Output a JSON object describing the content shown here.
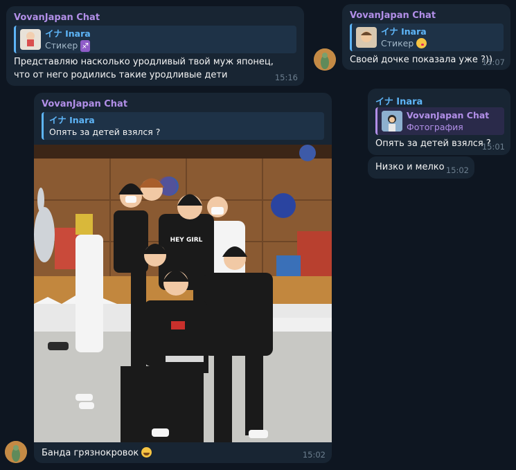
{
  "messages": {
    "m1": {
      "sender": "VovanJapan Chat",
      "reply_name": "イナ Inara",
      "reply_sub": "Стикер",
      "reply_emoji": "♐",
      "text": "Представляю насколько уродливый твой муж японец, что от него родились такие уродливые дети",
      "time": "15:16"
    },
    "m2": {
      "sender": "VovanJapan Chat",
      "reply_name": "イナ Inara",
      "reply_sub": "Стикер",
      "text": "Своей дочке показала уже ?))",
      "time": "15:07"
    },
    "m3": {
      "sender": "イナ Inara",
      "reply_name": "VovanJapan Chat",
      "reply_sub": "Фотография",
      "text": "Опять за детей взялся ?",
      "time": "15:01"
    },
    "m4": {
      "text": "Низко и мелко",
      "time": "15:02"
    },
    "m5": {
      "sender": "VovanJapan Chat",
      "reply_name": "イナ Inara",
      "reply_sub": "Опять за детей взялся ?",
      "photo_shirt_text": "HEY GIRL",
      "text": "Банда грязнокровок",
      "time": "15:02"
    }
  },
  "colors": {
    "background": "#0e1621",
    "bubble": "#182533",
    "accent_blue": "#5eb5f7",
    "accent_purple": "#b28fe8",
    "time": "#6d7f8f"
  }
}
